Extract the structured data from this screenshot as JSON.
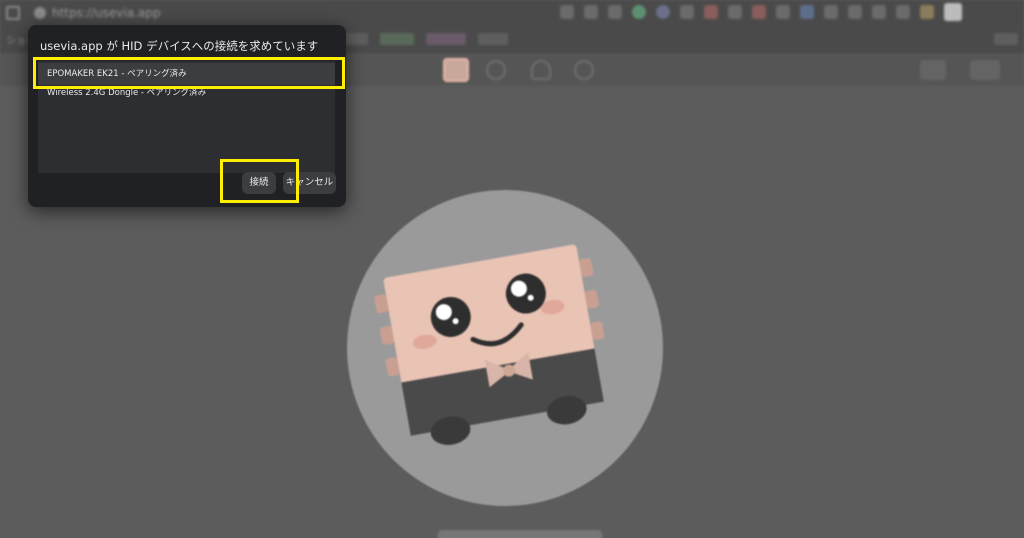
{
  "browser": {
    "url": "https://usevia.app",
    "bookmarks_label": "ショートカ"
  },
  "dialog": {
    "title": "usevia.app が HID デバイスへの接続を求めています",
    "devices": [
      {
        "label": "EPOMAKER EK21 - ペアリング済み",
        "selected": true
      },
      {
        "label": "Wireless 2.4G Dongle - ペアリング済み",
        "selected": false
      }
    ],
    "connect_label": "接続",
    "cancel_label": "キャンセル"
  },
  "toolbar": {
    "icons": [
      "keyboard-icon",
      "mouse-icon",
      "bulb-icon",
      "settings-icon"
    ]
  },
  "colors": {
    "highlight": "#ffee00",
    "dialog_bg": "#202124",
    "mascot_skin": "#e9c3b4",
    "page_bg": "#5c5c5c"
  }
}
